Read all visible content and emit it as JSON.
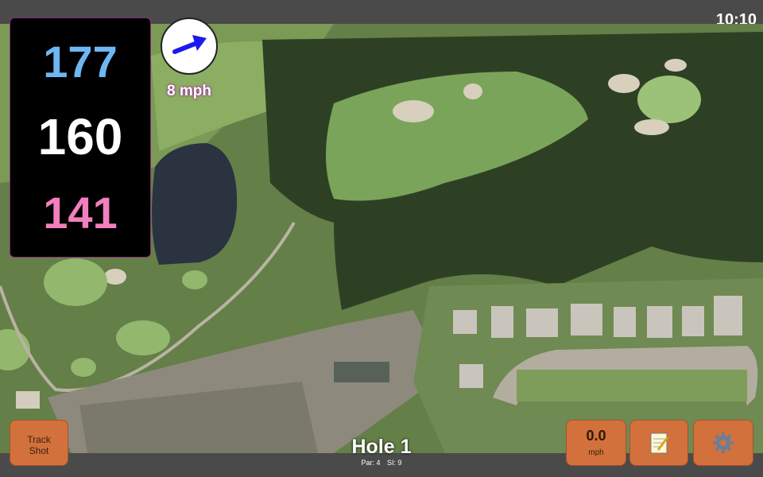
{
  "status": {
    "time": "10:10"
  },
  "yardages": {
    "back": "177",
    "center": "160",
    "front": "141"
  },
  "wind": {
    "speed_label": "8 mph",
    "direction_icon": "wind-arrow-icon"
  },
  "buttons": {
    "track_shot": {
      "line1": "Track",
      "line2": "Shot"
    },
    "wind_speed": {
      "value": "0.0",
      "unit": "mph"
    },
    "notes_icon": "notepad-icon",
    "settings_icon": "gear-icon"
  },
  "hole": {
    "title": "Hole 1",
    "par": "Par: 4",
    "stroke_index": "SI: 9"
  },
  "colors": {
    "back": "#6db7f5",
    "center": "#ffffff",
    "front": "#f37fbf",
    "button": "#d2713b",
    "accent": "#a02a9b"
  }
}
